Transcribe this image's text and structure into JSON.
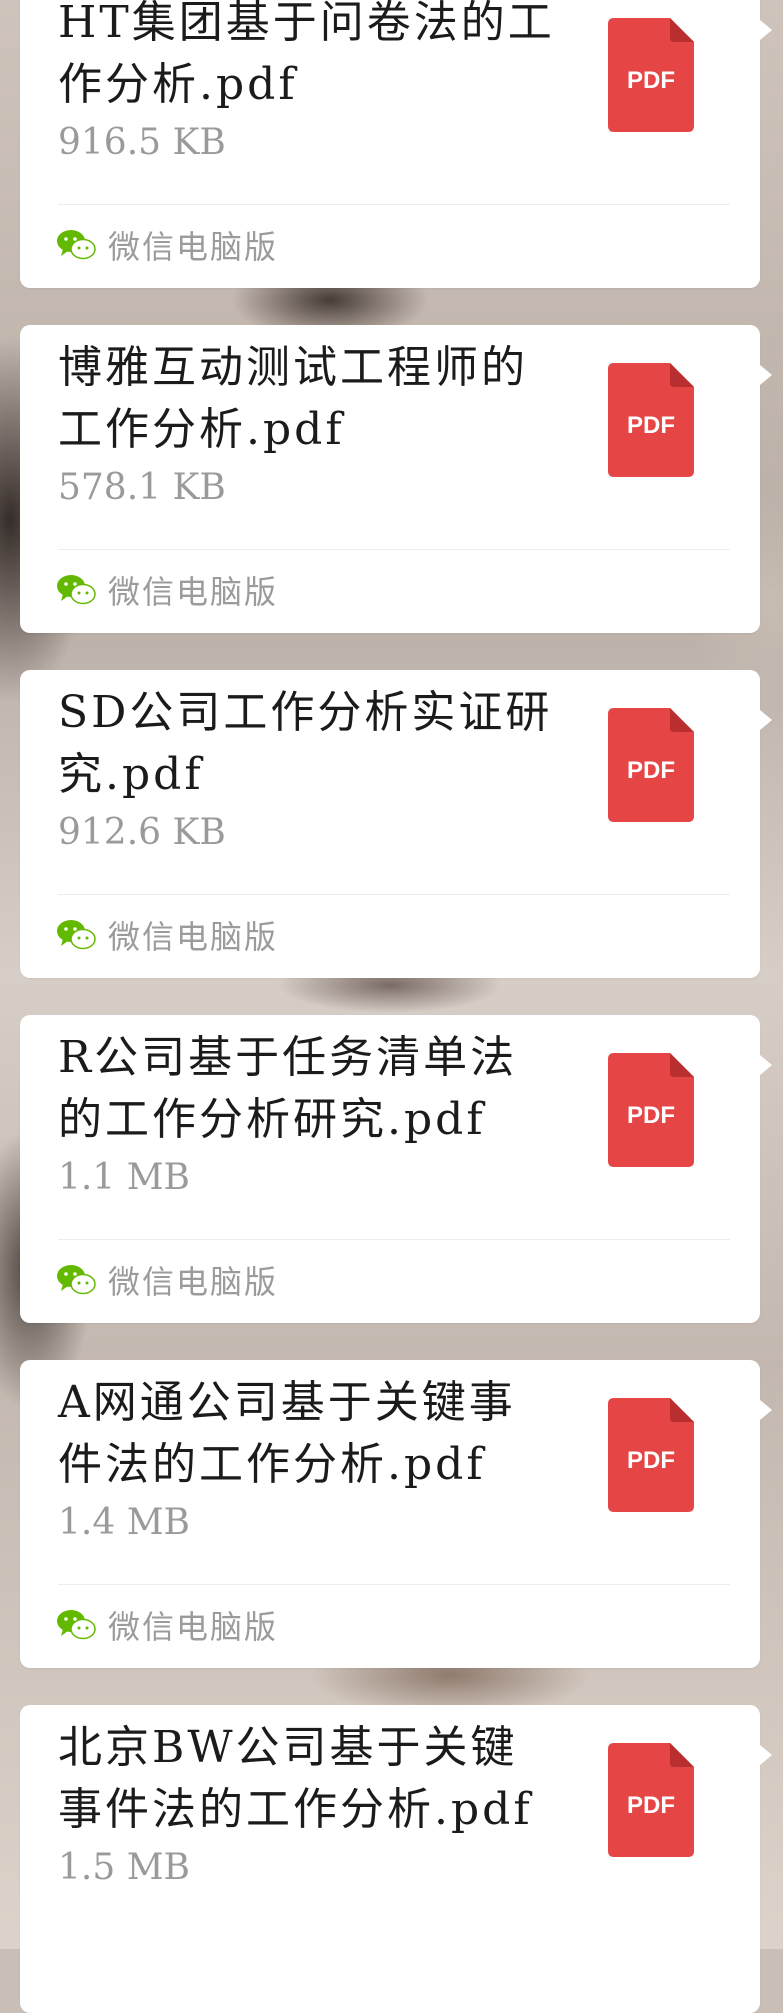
{
  "colors": {
    "pdf_red": "#e54545",
    "wechat_green": "#62b900",
    "card_bg": "#ffffff",
    "meta_gray": "#9a9a9a"
  },
  "messages": [
    {
      "file_name": "HT集团基于问卷法的工作分析.pdf",
      "file_size": "916.5 KB",
      "file_type_label": "PDF",
      "source_label": "微信电脑版",
      "source_icon": "wechat-icon"
    },
    {
      "file_name": "博雅互动测试工程师的工作分析.pdf",
      "file_size": "578.1 KB",
      "file_type_label": "PDF",
      "source_label": "微信电脑版",
      "source_icon": "wechat-icon"
    },
    {
      "file_name": "SD公司工作分析实证研究.pdf",
      "file_size": "912.6 KB",
      "file_type_label": "PDF",
      "source_label": "微信电脑版",
      "source_icon": "wechat-icon"
    },
    {
      "file_name": "R公司基于任务清单法的工作分析研究.pdf",
      "file_size": "1.1 MB",
      "file_type_label": "PDF",
      "source_label": "微信电脑版",
      "source_icon": "wechat-icon"
    },
    {
      "file_name": "A网通公司基于关键事件法的工作分析.pdf",
      "file_size": "1.4 MB",
      "file_type_label": "PDF",
      "source_label": "微信电脑版",
      "source_icon": "wechat-icon"
    },
    {
      "file_name": "北京BW公司基于关键事件法的工作分析.pdf",
      "file_size": "1.5 MB",
      "file_type_label": "PDF",
      "source_label": "",
      "source_icon": "pdf-file-icon"
    }
  ]
}
